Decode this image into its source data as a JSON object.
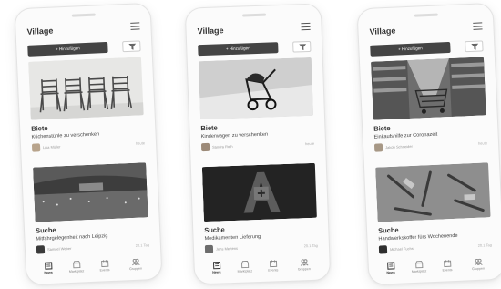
{
  "screens": [
    {
      "app_title": "Village",
      "add_button": "+ Hinzufügen",
      "cards": [
        {
          "type": "Biete",
          "title": "Küchenstühle zu verschenken",
          "author": "Lisa Müller",
          "date": "heute"
        },
        {
          "type": "Suche",
          "title": "Mitfahrgelegenheit nach Leipzig",
          "author": "Samuel Weber",
          "date": "20.1 Tag"
        }
      ],
      "tabs": [
        "News",
        "Marktplatz",
        "Events",
        "Gruppen"
      ],
      "active_tab": "News"
    },
    {
      "app_title": "Village",
      "add_button": "+ Hinzufügen",
      "cards": [
        {
          "type": "Biete",
          "title": "Kinderwagen zu verschenken",
          "author": "Sandra Roth",
          "date": "heute"
        },
        {
          "type": "Suche",
          "title": "Medikamenten Lieferung",
          "author": "Jens Mertens",
          "date": "20.1 Tag"
        }
      ],
      "tabs": [
        "News",
        "Marktplatz",
        "Events",
        "Gruppen"
      ],
      "active_tab": "News"
    },
    {
      "app_title": "Village",
      "add_button": "+ Hinzufügen",
      "cards": [
        {
          "type": "Biete",
          "title": "Einkaufshilfe zur Coronazeit",
          "author": "Jakob Schneider",
          "date": "heute"
        },
        {
          "type": "Suche",
          "title": "Handwerkskoffer fürs Wochenende",
          "author": "Michael Fuchs",
          "date": "20.1 Tag"
        }
      ],
      "tabs": [
        "News",
        "Marktplatz",
        "Events",
        "Gruppen"
      ],
      "active_tab": "News"
    }
  ],
  "icons": {
    "menu": "hamburger-icon",
    "filter": "filter-icon",
    "tabs": [
      "news-icon",
      "marketplace-icon",
      "calendar-icon",
      "groups-icon"
    ]
  }
}
